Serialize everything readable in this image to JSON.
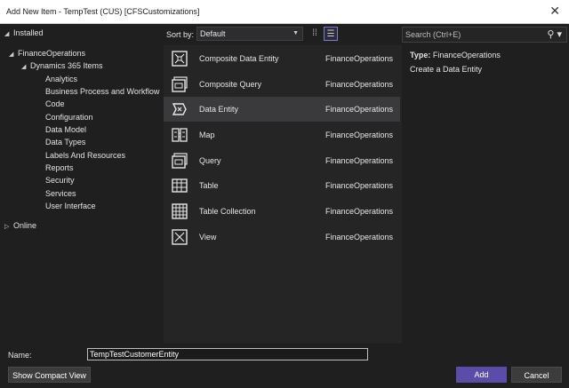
{
  "window": {
    "title": "Add New Item - TempTest (CUS) [CFSCustomizations]"
  },
  "tree": {
    "installed": "Installed",
    "finance_ops": "FinanceOperations",
    "dynamics": "Dynamics 365 Items",
    "children": [
      "Analytics",
      "Business Process and Workflow",
      "Code",
      "Configuration",
      "Data Model",
      "Data Types",
      "Labels And Resources",
      "Reports",
      "Security",
      "Services",
      "User Interface"
    ],
    "online": "Online"
  },
  "sort": {
    "label": "Sort by:",
    "value": "Default"
  },
  "items": [
    {
      "name": "Composite Data Entity",
      "category": "FinanceOperations",
      "icon": "composite-data-entity-icon"
    },
    {
      "name": "Composite Query",
      "category": "FinanceOperations",
      "icon": "composite-query-icon"
    },
    {
      "name": "Data Entity",
      "category": "FinanceOperations",
      "icon": "data-entity-icon"
    },
    {
      "name": "Map",
      "category": "FinanceOperations",
      "icon": "map-icon"
    },
    {
      "name": "Query",
      "category": "FinanceOperations",
      "icon": "query-icon"
    },
    {
      "name": "Table",
      "category": "FinanceOperations",
      "icon": "table-icon"
    },
    {
      "name": "Table Collection",
      "category": "FinanceOperations",
      "icon": "table-collection-icon"
    },
    {
      "name": "View",
      "category": "FinanceOperations",
      "icon": "view-icon"
    }
  ],
  "search": {
    "placeholder": "Search (Ctrl+E)"
  },
  "details": {
    "type_label": "Type:",
    "type_value": "FinanceOperations",
    "description": "Create a Data Entity"
  },
  "bottom": {
    "name_label": "Name:",
    "name_value": "TempTestCustomerEntity",
    "compact_view": "Show Compact View",
    "add": "Add",
    "cancel": "Cancel"
  }
}
